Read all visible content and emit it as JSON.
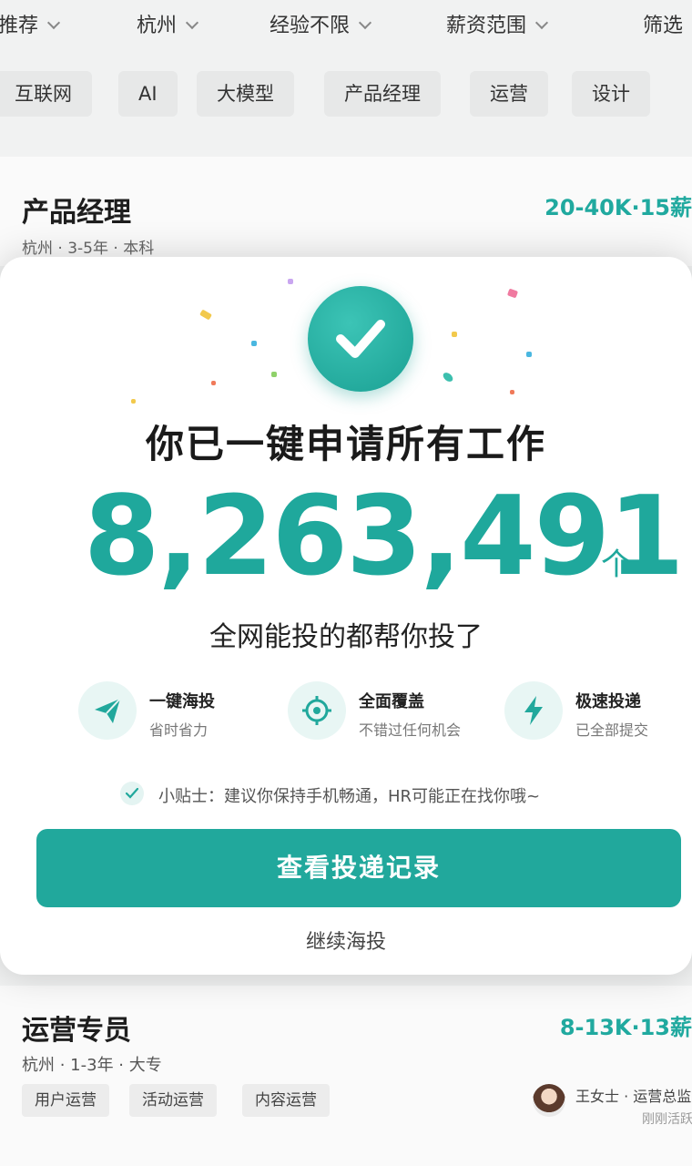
{
  "filters": [
    {
      "label": "推荐"
    },
    {
      "label": "杭州"
    },
    {
      "label": "经验不限"
    },
    {
      "label": "薪资范围"
    },
    {
      "label": "筛选"
    }
  ],
  "tags": [
    "互联网",
    "AI",
    "大模型",
    "产品经理",
    "运营",
    "设计"
  ],
  "job1": {
    "title": "产品经理",
    "salary": "20-40K·15薪",
    "meta": "杭州 · 3-5年 · 本科"
  },
  "modal": {
    "title": "你已一键申请所有工作",
    "count": "8,263,491",
    "unit": "个",
    "subtitle": "全网能投的都帮你投了",
    "features": [
      {
        "title": "一键海投",
        "desc": "省时省力",
        "icon": "paper-plane-icon"
      },
      {
        "title": "全面覆盖",
        "desc": "不错过任何机会",
        "icon": "target-icon"
      },
      {
        "title": "极速投递",
        "desc": "已全部提交",
        "icon": "lightning-icon"
      }
    ],
    "tip": "小贴士：建议你保持手机畅通，HR可能正在找你哦~",
    "primary_button": "查看投递记录",
    "secondary_button": "继续海投",
    "accent_color": "#21a89c"
  },
  "job2": {
    "title": "运营专员",
    "salary": "8-13K·13薪",
    "meta": "杭州 · 1-3年 · 大专",
    "skills": [
      "用户运营",
      "活动运营",
      "内容运营"
    ],
    "recruiter_name": "王女士 · 运营总监",
    "recruiter_status": "刚刚活跃"
  }
}
